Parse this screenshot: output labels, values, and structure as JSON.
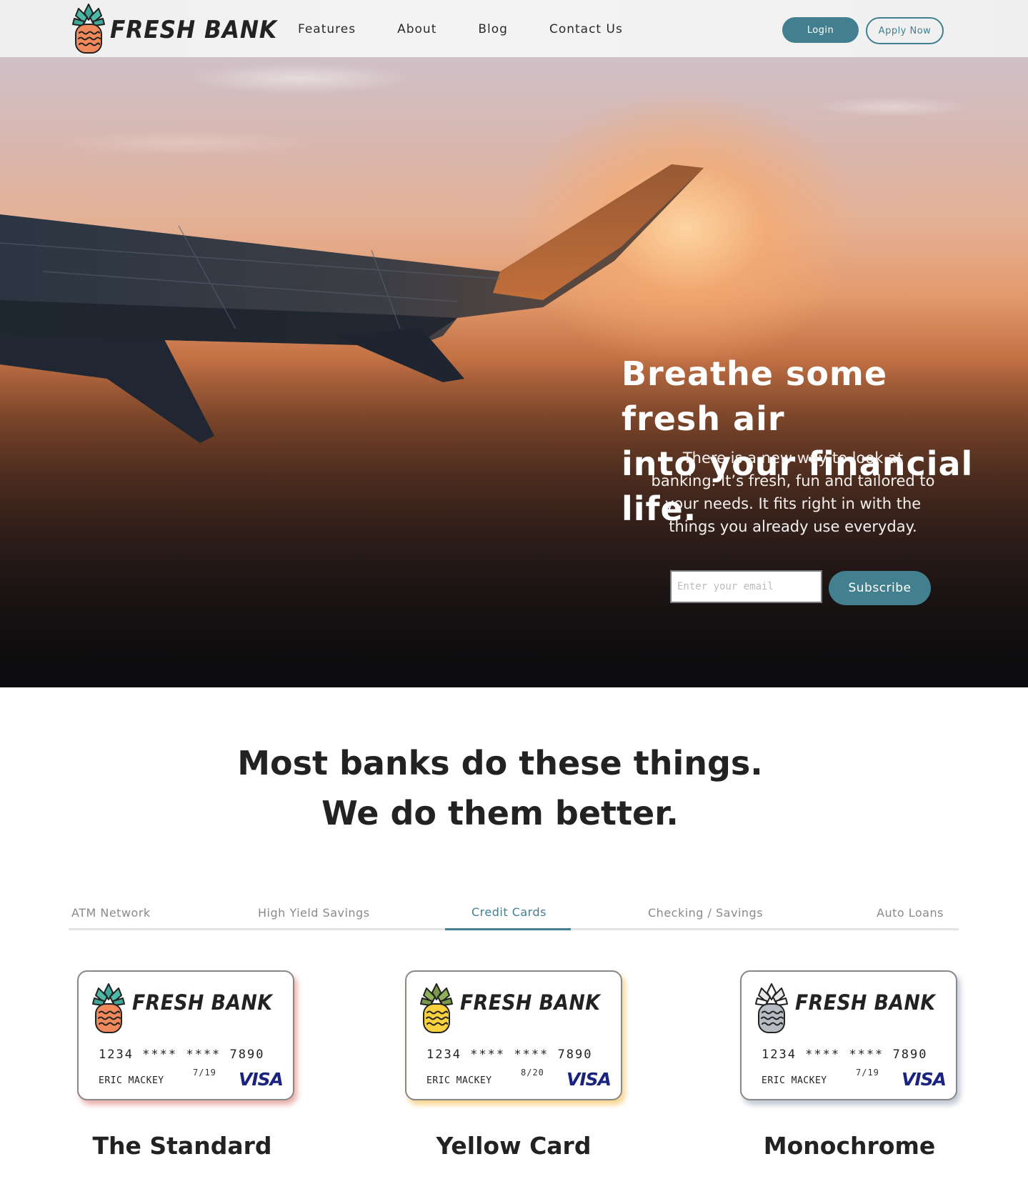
{
  "header": {
    "brand": "FRESH BANK",
    "nav": [
      "Features",
      "About",
      "Blog",
      "Contact Us"
    ],
    "login_label": "Login",
    "apply_label": "Apply Now"
  },
  "hero": {
    "title_line1": "Breathe some fresh air",
    "title_line2": "into your financial life.",
    "description": "There is a new way to look at banking. It’s fresh, fun and tailored to your needs. It fits right in with the things you already use everyday.",
    "email_placeholder": "Enter your email",
    "subscribe_label": "Subscribe"
  },
  "section": {
    "title_line1": "Most banks do these things.",
    "title_line2": "We do them better."
  },
  "tabs": {
    "items": [
      "ATM Network",
      "High Yield Savings",
      "Credit Cards",
      "Checking / Savings",
      "Auto Loans"
    ],
    "active": "Credit Cards"
  },
  "cards": [
    {
      "brand": "FRESH BANK",
      "number": "1234 **** **** 7890",
      "expiry": "7/19",
      "holder": "ERIC MACKEY",
      "network": "VISA",
      "name": "The Standard",
      "accent": "#f08a5d"
    },
    {
      "brand": "FRESH BANK",
      "number": "1234 **** **** 7890",
      "expiry": "8/20",
      "holder": "ERIC MACKEY",
      "network": "VISA",
      "name": "Yellow Card",
      "accent": "#f7d13e"
    },
    {
      "brand": "FRESH BANK",
      "number": "1234 **** **** 7890",
      "expiry": "7/19",
      "holder": "ERIC MACKEY",
      "network": "VISA",
      "name": "Monochrome",
      "accent": "#b7bcc4"
    }
  ],
  "colors": {
    "primary": "#42808f",
    "text": "#222222",
    "tab_inactive": "#8a8a8a",
    "card_network": "#1a237e"
  },
  "icons": {
    "logo": "pineapple-icon"
  }
}
